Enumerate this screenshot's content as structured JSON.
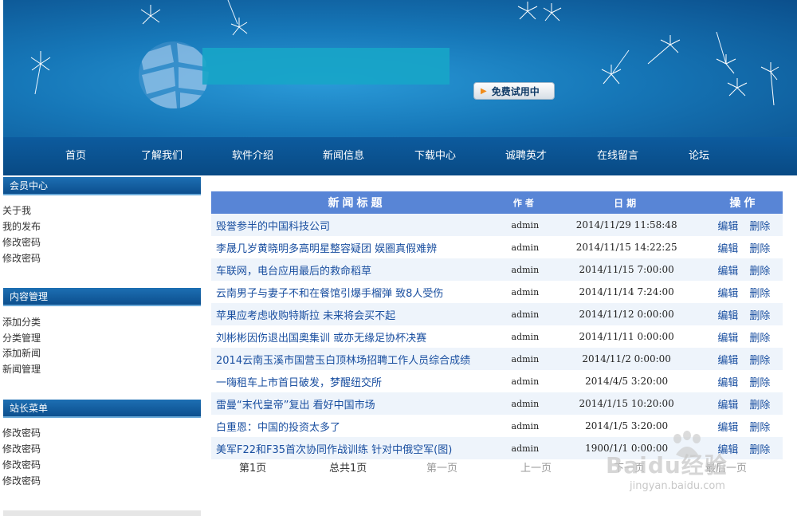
{
  "banner": {
    "trial_button": "免费试用中"
  },
  "nav": {
    "items": [
      "首页",
      "了解我们",
      "软件介绍",
      "新闻信息",
      "下载中心",
      "诚聘英才",
      "在线留言",
      "论坛"
    ]
  },
  "sidebar": {
    "sections": [
      {
        "title": "会员中心",
        "links": [
          "关于我",
          "我的发布",
          "修改密码",
          "修改密码"
        ]
      },
      {
        "title": "内容管理",
        "links": [
          "添加分类",
          "分类管理",
          "添加新闻",
          "新闻管理"
        ]
      },
      {
        "title": "站长菜单",
        "links": [
          "修改密码",
          "修改密码",
          "修改密码",
          "修改密码"
        ]
      }
    ]
  },
  "table": {
    "headers": {
      "title": "新闻标题",
      "author": "作者",
      "date": "日期",
      "ops": "操作"
    },
    "edit_label": "编辑",
    "delete_label": "删除",
    "rows": [
      {
        "title": "毁誉参半的中国科技公司",
        "author": "admin",
        "date": "2014/11/29 11:58:48"
      },
      {
        "title": "李晟几岁黄晓明多高明星整容疑团 娱圈真假难辨",
        "author": "admin",
        "date": "2014/11/15 14:22:25"
      },
      {
        "title": "车联网，电台应用最后的救命稻草",
        "author": "admin",
        "date": "2014/11/15 7:00:00"
      },
      {
        "title": "云南男子与妻子不和在餐馆引爆手榴弹 致8人受伤",
        "author": "admin",
        "date": "2014/11/14 7:24:00"
      },
      {
        "title": "苹果应考虑收购特斯拉 未来将会买不起",
        "author": "admin",
        "date": "2014/11/12 0:00:00"
      },
      {
        "title": "刘彬彬因伤退出国奥集训 或亦无缘足协杯决赛",
        "author": "admin",
        "date": "2014/11/11 0:00:00"
      },
      {
        "title": "2014云南玉溪市国营玉白顶林场招聘工作人员综合成绩",
        "author": "admin",
        "date": "2014/11/2 0:00:00"
      },
      {
        "title": "一嗨租车上市首日破发，梦醒纽交所",
        "author": "admin",
        "date": "2014/4/5 3:20:00"
      },
      {
        "title": "雷曼“末代皇帝”复出 看好中国市场",
        "author": "admin",
        "date": "2014/1/15 10:20:00"
      },
      {
        "title": "白重恩：中国的投资太多了",
        "author": "admin",
        "date": "2014/1/5 3:20:00"
      },
      {
        "title": "美军F22和F35首次协同作战训练 针对中俄空军(图)",
        "author": "admin",
        "date": "1900/1/1 0:00:00"
      }
    ]
  },
  "pager": {
    "current": "第1页",
    "total": "总共1页",
    "first": "第一页",
    "prev": "上一页",
    "next": "下一页",
    "last": "最后一页"
  },
  "watermark": {
    "main": "Baidu经验",
    "sub": "jingyan.baidu.com"
  }
}
